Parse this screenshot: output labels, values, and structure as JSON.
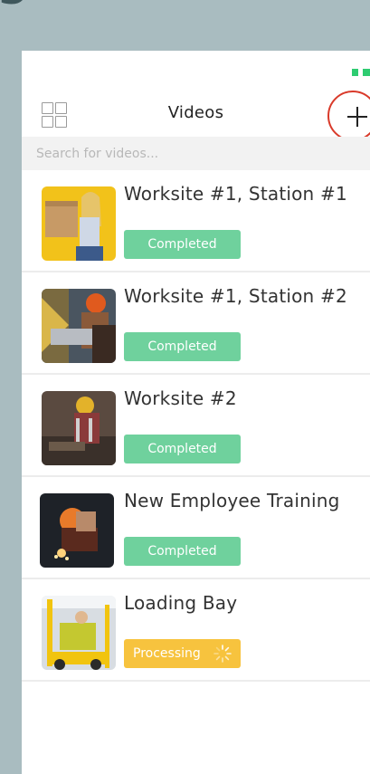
{
  "header": {
    "title": "Videos",
    "add_icon": "plus-icon",
    "grid_icon": "grid-icon"
  },
  "search": {
    "placeholder": "Search for videos..."
  },
  "videos": [
    {
      "title": "Worksite #1, Station #1",
      "status": "Completed",
      "status_type": "completed"
    },
    {
      "title": "Worksite #1, Station #2",
      "status": "Completed",
      "status_type": "completed"
    },
    {
      "title": "Worksite #2",
      "status": "Completed",
      "status_type": "completed"
    },
    {
      "title": "New Employee Training",
      "status": "Completed",
      "status_type": "completed"
    },
    {
      "title": "Loading Bay",
      "status": "Processing",
      "status_type": "processing"
    }
  ],
  "colors": {
    "completed": "#6fd19d",
    "processing": "#f7c33e",
    "add_ring": "#d93a2a",
    "battery": "#2ecc71"
  }
}
